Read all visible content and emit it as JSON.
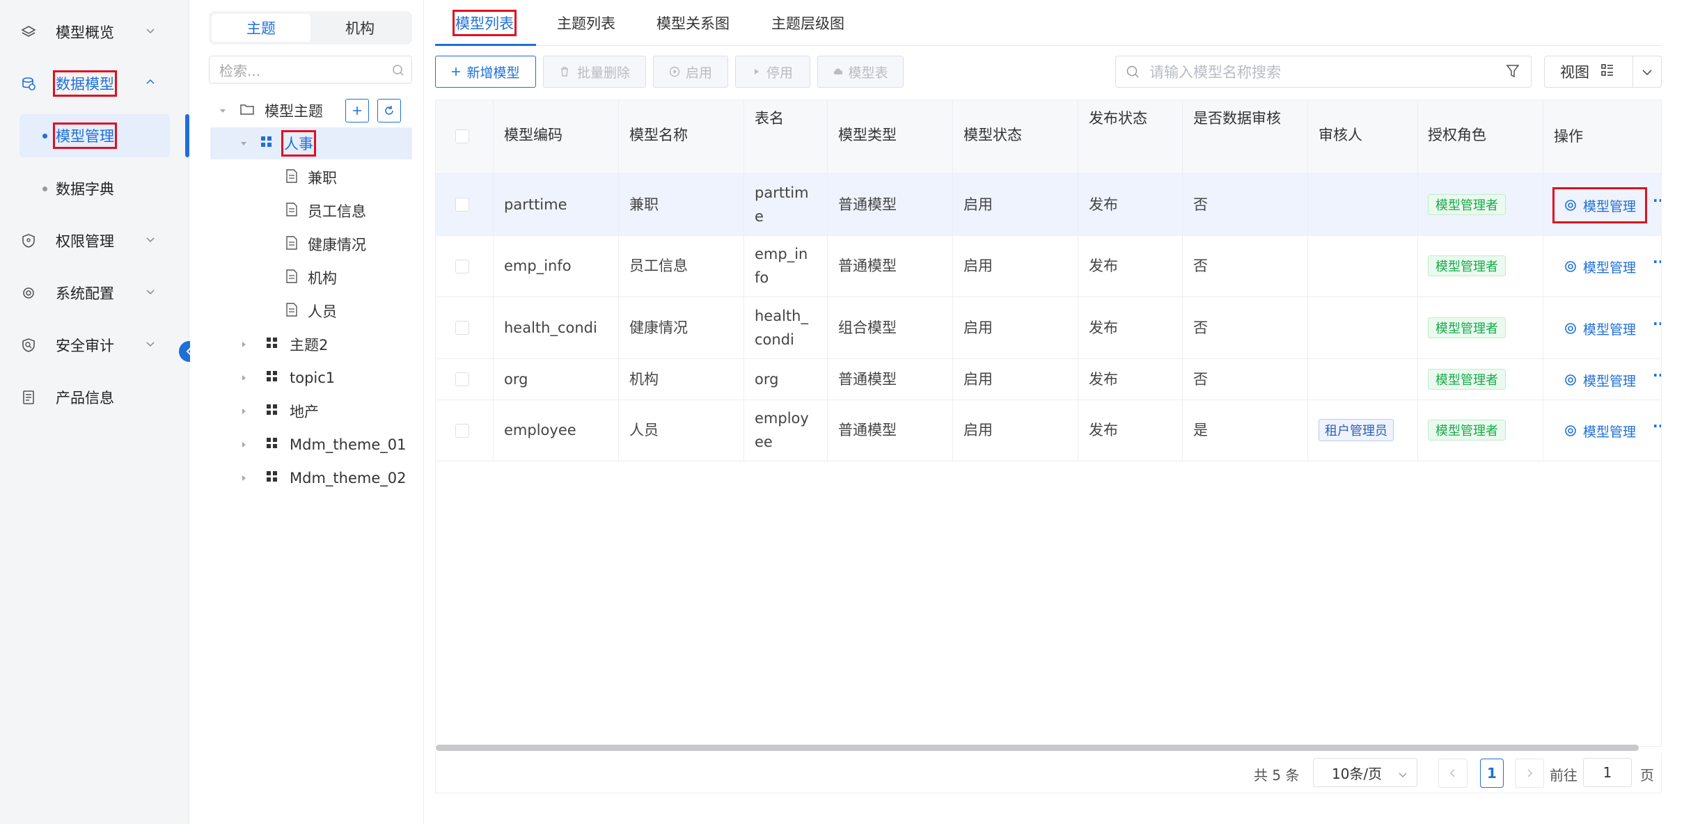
{
  "nav": {
    "items": [
      {
        "label": "模型概览",
        "icon": "layers-icon"
      },
      {
        "label": "数据模型",
        "icon": "database-icon"
      },
      {
        "label": "模型管理"
      },
      {
        "label": "数据字典"
      },
      {
        "label": "权限管理",
        "icon": "shield-icon"
      },
      {
        "label": "系统配置",
        "icon": "gear-icon"
      },
      {
        "label": "安全审计",
        "icon": "audit-shield-icon"
      },
      {
        "label": "产品信息",
        "icon": "document-icon"
      }
    ]
  },
  "tree": {
    "seg_theme": "主题",
    "seg_org": "机构",
    "search_placeholder": "检索...",
    "root": "模型主题",
    "nodes": [
      "人事",
      "兼职",
      "员工信息",
      "健康情况",
      "机构",
      "人员",
      "主题2",
      "topic1",
      "地产",
      "Mdm_theme_01",
      "Mdm_theme_02"
    ]
  },
  "tabs": [
    "模型列表",
    "主题列表",
    "模型关系图",
    "主题层级图"
  ],
  "toolbar": {
    "add": "新增模型",
    "batch_delete": "批量删除",
    "enable": "启用",
    "disable": "停用",
    "model_table": "模型表",
    "search_placeholder": "请输入模型名称搜索",
    "view": "视图"
  },
  "table": {
    "headers": [
      "模型编码",
      "模型名称",
      "表名",
      "模型类型",
      "模型状态",
      "发布状态",
      "是否数据审核",
      "审核人",
      "授权角色",
      "操作"
    ],
    "rows": [
      {
        "code": "parttime",
        "name": "兼职",
        "table_l1": "parttim",
        "table_l2": "e",
        "type": "普通模型",
        "status": "启用",
        "publish": "发布",
        "audit": "否",
        "auditor": "",
        "role": "模型管理者",
        "op": "模型管理"
      },
      {
        "code": "emp_info",
        "name": "员工信息",
        "table_l1": "emp_in",
        "table_l2": "fo",
        "type": "普通模型",
        "status": "启用",
        "publish": "发布",
        "audit": "否",
        "auditor": "",
        "role": "模型管理者",
        "op": "模型管理"
      },
      {
        "code": "health_condi",
        "name": "健康情况",
        "table_l1": "health_",
        "table_l2": "condi",
        "type": "组合模型",
        "status": "启用",
        "publish": "发布",
        "audit": "否",
        "auditor": "",
        "role": "模型管理者",
        "op": "模型管理"
      },
      {
        "code": "org",
        "name": "机构",
        "table_l1": "org",
        "table_l2": "",
        "type": "普通模型",
        "status": "启用",
        "publish": "发布",
        "audit": "否",
        "auditor": "",
        "role": "模型管理者",
        "op": "模型管理"
      },
      {
        "code": "employee",
        "name": "人员",
        "table_l1": "employ",
        "table_l2": "ee",
        "type": "普通模型",
        "status": "启用",
        "publish": "发布",
        "audit": "是",
        "auditor": "租户管理员",
        "role": "模型管理者",
        "op": "模型管理"
      }
    ],
    "more": "··"
  },
  "pager": {
    "total": "共 5 条",
    "page_size": "10条/页",
    "current": "1",
    "goto_prefix": "前往",
    "goto_value": "1",
    "goto_suffix": "页"
  },
  "colors": {
    "accent": "#1e6fd9",
    "highlight": "#e0101e",
    "tag_green": "#1aa84c"
  }
}
